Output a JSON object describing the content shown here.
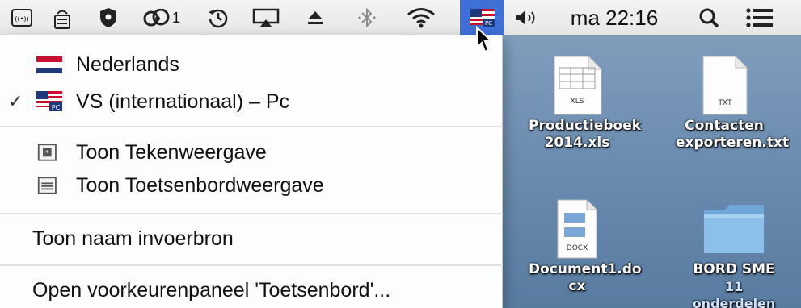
{
  "menubar": {
    "icons": [
      {
        "name": "bluetooth-broadcast-icon"
      },
      {
        "name": "keyboard-input-icon"
      },
      {
        "name": "shield-icon"
      },
      {
        "name": "creative-cloud-icon",
        "badge": "1"
      },
      {
        "name": "time-machine-icon"
      },
      {
        "name": "airplay-icon"
      },
      {
        "name": "eject-icon"
      },
      {
        "name": "bluetooth-icon"
      },
      {
        "name": "wifi-icon"
      },
      {
        "name": "us-pc-flag-icon"
      },
      {
        "name": "volume-icon"
      }
    ],
    "clock": "ma 22:16",
    "search_icon": "spotlight-search-icon",
    "list_icon": "notification-center-icon",
    "accent_color": "#3e70d6"
  },
  "menu": {
    "items": [
      {
        "label": "Nederlands",
        "icon": "netherlands-flag-icon",
        "checked": false
      },
      {
        "label": "VS (internationaal) – Pc",
        "icon": "us-pc-flag-icon",
        "checked": true
      },
      {
        "label": "Toon Tekenweergave",
        "icon": "character-viewer-icon"
      },
      {
        "label": "Toon Toetsenbordweergave",
        "icon": "keyboard-viewer-icon"
      },
      {
        "label": "Toon naam invoerbron"
      },
      {
        "label": "Open voorkeurenpaneel 'Toetsenbord'..."
      }
    ],
    "checkmark": "✓"
  },
  "desktop": {
    "icons": [
      {
        "name": "Productieboek\n2014.xls",
        "line1": "Productieboek",
        "line2": "2014.xls",
        "type": "XLS"
      },
      {
        "name": "Contacten\nexporteren.txt",
        "line1": "Contacten",
        "line2": "exporteren.txt",
        "type": "TXT"
      },
      {
        "name": "Document1.docx",
        "line1": "Document1.do",
        "line2": "cx",
        "type": "DOCX"
      },
      {
        "name": "BORD SME",
        "line1": "BORD SME",
        "line2": "11 onderdelen",
        "type": "folder"
      }
    ]
  }
}
